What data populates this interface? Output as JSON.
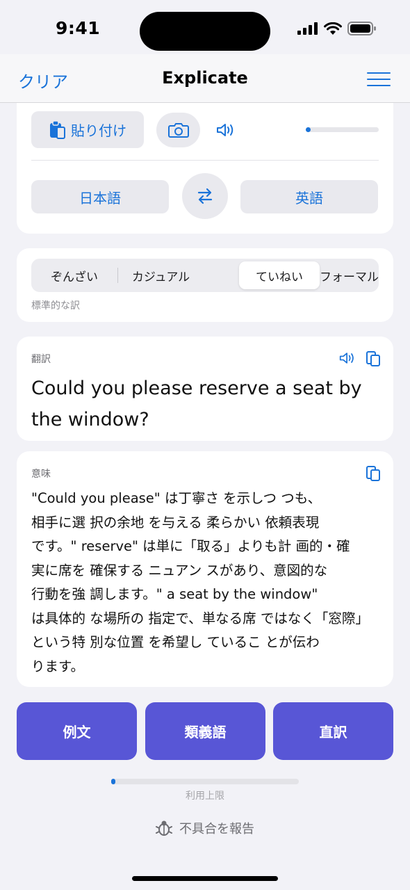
{
  "status": {
    "time": "9:41"
  },
  "nav": {
    "left": "クリア",
    "title": "Explicate"
  },
  "input_card": {
    "paste_label": "貼り付け",
    "source_lang": "日本語",
    "target_lang": "英語",
    "speech_rate": 0.02
  },
  "tone": {
    "options": [
      "ぞんざい",
      "カジュアル",
      "ていねい",
      "フォーマル"
    ],
    "selected": "ていねい",
    "caption": "標準的な訳"
  },
  "translation": {
    "label": "翻訳",
    "line1": "Could you please reserve a seat by",
    "line2": "the window?"
  },
  "meaning": {
    "label": "意味",
    "lines": [
      "\"Could you please\" は丁寧さ を示しつ つも、",
      "相手に選 択の余地 を与える 柔らかい 依頼表現",
      "です。\" reserve\" は単に「取る」よりも計 画的・確",
      "実に席を 確保する ニュアン スがあり、意図的な",
      "行動を強 調します。\" a seat by the window\"",
      "は具体的 な場所の 指定で、単なる席 ではなく「窓際」",
      "という特 別な位置 を希望し ているこ とが伝わ",
      "ります。"
    ]
  },
  "actions": {
    "examples": "例文",
    "synonyms": "類義語",
    "literal": "直訳"
  },
  "usage": {
    "label": "利用上限",
    "fraction": 0.02
  },
  "report": {
    "label": "不具合を報告"
  },
  "colors": {
    "accent": "#1a73d9",
    "action": "#5856d6",
    "background": "#f2f2f7"
  },
  "icons": {
    "paste": "clipboard-icon",
    "camera": "camera-icon",
    "speaker": "speaker-icon",
    "swap": "swap-arrows-icon",
    "copy": "copy-icon",
    "menu": "hamburger-menu-icon",
    "bug": "bug-icon"
  }
}
